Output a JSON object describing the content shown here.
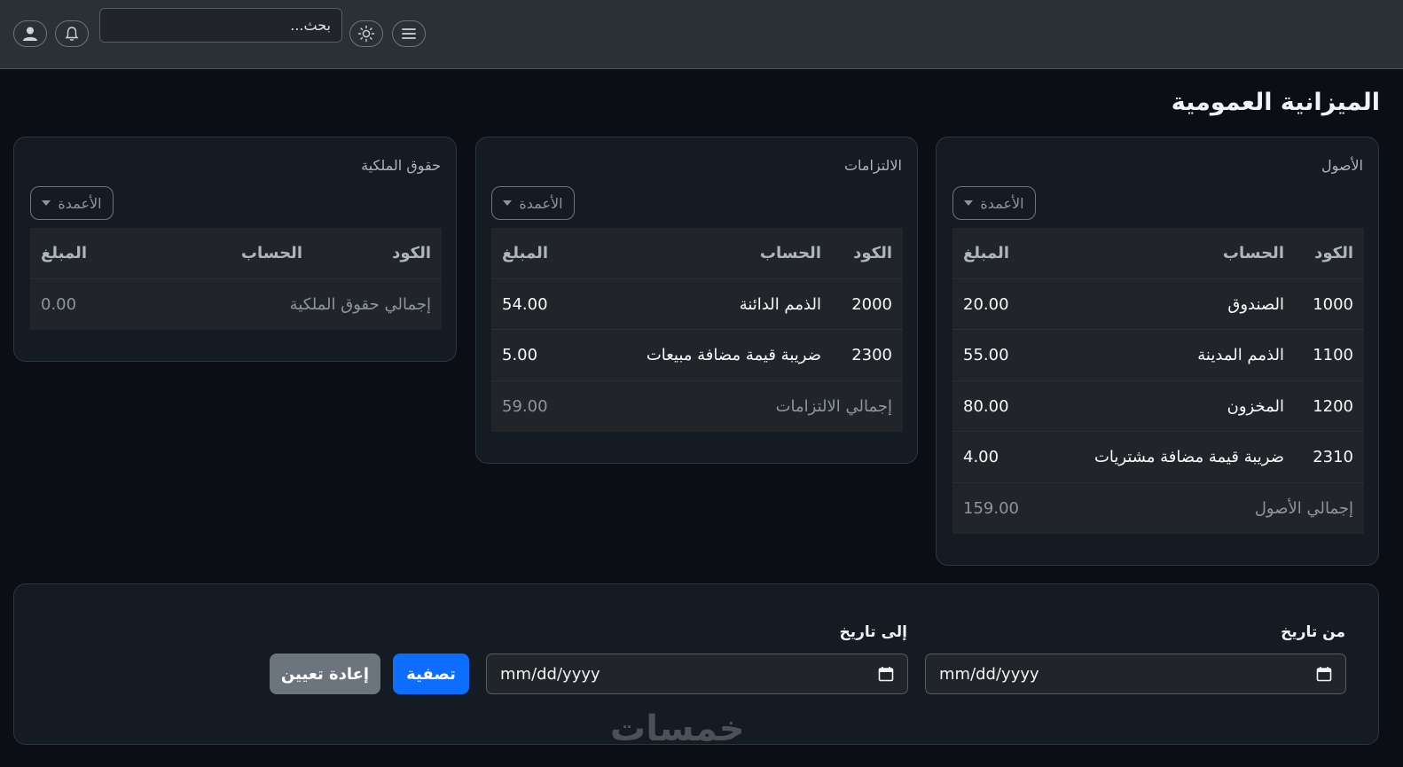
{
  "header": {
    "search_placeholder": "بحث...",
    "icons": [
      "menu-icon",
      "sun-icon",
      "bell-icon",
      "user-icon"
    ]
  },
  "page": {
    "title": "الميزانية العمومية"
  },
  "columns_label": "الأعمدة",
  "table_headers": {
    "code": "الكود",
    "account": "الحساب",
    "amount": "المبلغ"
  },
  "assets": {
    "title": "الأصول",
    "rows": [
      {
        "code": "1000",
        "account": "الصندوق",
        "amount": "20.00"
      },
      {
        "code": "1100",
        "account": "الذمم المدينة",
        "amount": "55.00"
      },
      {
        "code": "1200",
        "account": "المخزون",
        "amount": "80.00"
      },
      {
        "code": "2310",
        "account": "ضريبة قيمة مضافة مشتريات",
        "amount": "4.00"
      }
    ],
    "total_label": "إجمالي الأصول",
    "total_amount": "159.00"
  },
  "liabilities": {
    "title": "الالتزامات",
    "rows": [
      {
        "code": "2000",
        "account": "الذمم الدائنة",
        "amount": "54.00"
      },
      {
        "code": "2300",
        "account": "ضريبة قيمة مضافة مبيعات",
        "amount": "5.00"
      }
    ],
    "total_label": "إجمالي الالتزامات",
    "total_amount": "59.00"
  },
  "equity": {
    "title": "حقوق الملكية",
    "rows": [],
    "total_label": "إجمالي حقوق الملكية",
    "total_amount": "0.00"
  },
  "filter": {
    "from_label": "من تاريخ",
    "to_label": "إلى تاريخ",
    "from_value": "mm/dd/yyyy",
    "to_value": "mm/dd/yyyy",
    "filter_button": "تصفية",
    "reset_button": "إعادة تعيين"
  },
  "watermark": "خمسات",
  "colors": {
    "background": "#0b0f15",
    "card": "#151b23",
    "primary": "#0d6efd",
    "secondary": "#6c757d"
  }
}
